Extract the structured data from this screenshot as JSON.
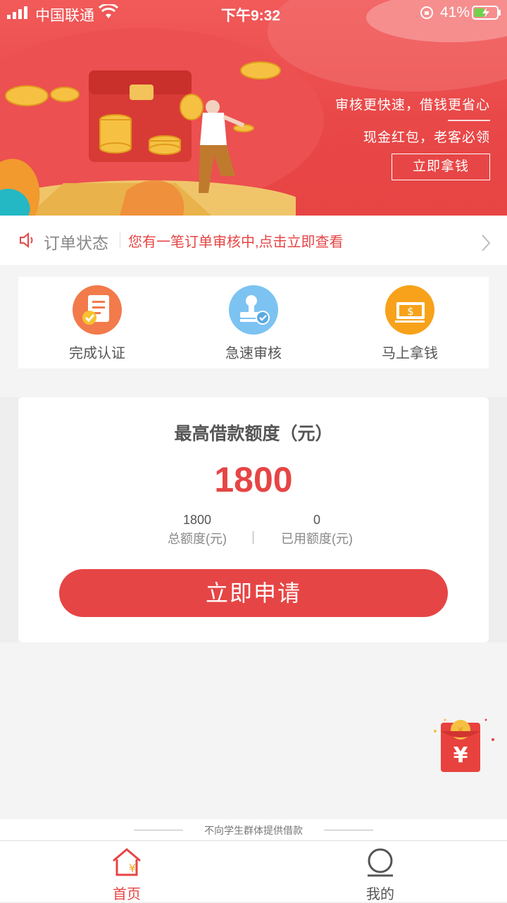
{
  "status_bar": {
    "carrier": "中国联通",
    "time": "下午9:32",
    "battery": "41%"
  },
  "hero": {
    "slogan_1": "审核更快速，借钱更省心",
    "slogan_2": "现金红包，老客必领",
    "cta": "立即拿钱"
  },
  "notice": {
    "label": "订单状态",
    "message": "您有一笔订单审核中,点击立即查看"
  },
  "steps": [
    {
      "label": "完成认证",
      "icon": "document-check-icon",
      "color": "#f27a4b"
    },
    {
      "label": "急速审核",
      "icon": "stamp-check-icon",
      "color": "#7cc3f2"
    },
    {
      "label": "马上拿钱",
      "icon": "cash-icon",
      "color": "#f7a21a"
    }
  ],
  "loan": {
    "title": "最高借款额度（元）",
    "amount": "1800",
    "total_value": "1800",
    "total_label": "总额度(元)",
    "used_value": "0",
    "used_label": "已用额度(元)",
    "apply_label": "立即申请"
  },
  "footer": {
    "disclaimer": "不向学生群体提供借款",
    "tabs": [
      {
        "label": "首页",
        "icon": "home-yen-icon",
        "active": true
      },
      {
        "label": "我的",
        "icon": "user-icon",
        "active": false
      }
    ]
  },
  "colors": {
    "brand_red": "#e64545",
    "active_tab": "#e64545",
    "inactive_tab": "#555555"
  }
}
